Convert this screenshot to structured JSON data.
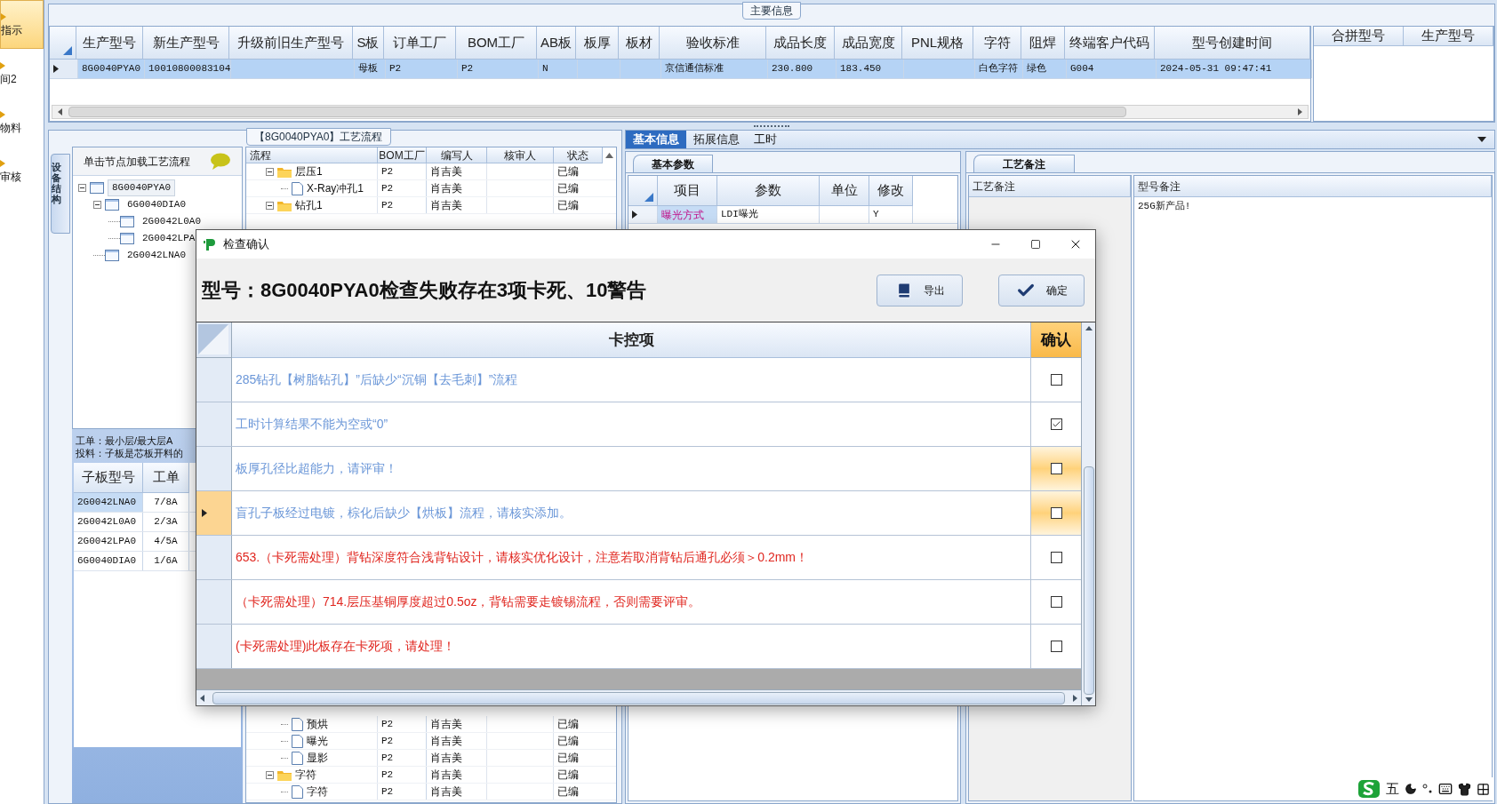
{
  "nav": {
    "items": [
      {
        "label": "指示",
        "selected": true
      },
      {
        "label": "间2",
        "selected": false
      },
      {
        "label": "物料",
        "selected": false
      },
      {
        "label": "审核",
        "selected": false
      }
    ]
  },
  "main_info": {
    "title": "主要信息",
    "columns": [
      "生产型号",
      "新生产型号",
      "升级前旧生产型号",
      "S板",
      "订单工厂",
      "BOM工厂",
      "AB板",
      "板厚",
      "板材",
      "验收标准",
      "成品长度",
      "成品宽度",
      "PNL规格",
      "字符",
      "阻焊",
      "终端客户代码",
      "型号创建时间"
    ],
    "rows": [
      {
        "selected": true,
        "cells": [
          "8G0040PYA0",
          "10010800083104",
          null,
          "母板",
          "P2",
          "P2",
          "N",
          null,
          null,
          "京信通信标准",
          "230.800",
          "183.450",
          null,
          "白色字符",
          "绿色",
          "G004",
          "2024-05-31 09:47:41"
        ]
      }
    ]
  },
  "merge_table": {
    "columns": [
      "合拼型号",
      "生产型号"
    ]
  },
  "flow_panel": {
    "title": "【8G0040PYA0】工艺流程",
    "side_tab": "设备结构",
    "tree_header": "单击节点加载工艺流程",
    "tree": [
      {
        "label": "8G0040PYA0",
        "selected": true,
        "expanded": true,
        "children": [
          {
            "label": "6G0040DIA0",
            "selected": false,
            "expanded": true,
            "children": [
              {
                "label": "2G0042L0A0",
                "selected": false
              },
              {
                "label": "2G0042LPA",
                "selected": false
              }
            ]
          },
          {
            "label": "2G0042LNA0",
            "selected": false
          }
        ]
      }
    ],
    "notes": [
      "工单：最小层/最大层A",
      "投料：子板是芯板开料的"
    ],
    "sub_table": {
      "columns": [
        "子板型号",
        "工单"
      ],
      "rows": [
        {
          "selected": true,
          "cells": [
            "2G0042LNA0",
            "7/8A"
          ]
        },
        {
          "selected": false,
          "cells": [
            "2G0042L0A0",
            "2/3A"
          ]
        },
        {
          "selected": false,
          "cells": [
            "2G0042LPA0",
            "4/5A"
          ]
        },
        {
          "selected": false,
          "cells": [
            "6G0040DIA0",
            "1/6A"
          ]
        }
      ]
    },
    "process_table": {
      "columns": [
        "流程",
        "BOM工厂",
        "编写人",
        "核审人",
        "状态"
      ],
      "rows_top": [
        {
          "name": "层压1",
          "kind": "folder",
          "expanded": true,
          "bom": "P2",
          "writer": "肖吉美",
          "status": "已编",
          "children": [
            {
              "name": "X-Ray冲孔1",
              "kind": "step",
              "bom": "P2",
              "writer": "肖吉美",
              "status": "已编"
            }
          ]
        },
        {
          "name": "钻孔1",
          "kind": "folder",
          "expanded": true,
          "bom": "P2",
          "writer": "肖吉美",
          "status": "已编"
        }
      ],
      "rows_bottom": [
        {
          "children": [
            {
              "name": "预烘",
              "kind": "step",
              "bom": "P2",
              "writer": "肖吉美",
              "status": "已编"
            },
            {
              "name": "曝光",
              "kind": "step",
              "bom": "P2",
              "writer": "肖吉美",
              "status": "已编"
            },
            {
              "name": "显影",
              "kind": "step",
              "bom": "P2",
              "writer": "肖吉美",
              "status": "已编"
            }
          ]
        },
        {
          "name": "字符",
          "kind": "folder",
          "expanded": true,
          "bom": "P2",
          "writer": "肖吉美",
          "status": "已编",
          "children": [
            {
              "name": "字符",
              "kind": "step",
              "bom": "P2",
              "writer": "肖吉美",
              "status": "已编"
            }
          ]
        }
      ]
    }
  },
  "detail_tabs": [
    {
      "label": "基本信息",
      "selected": true
    },
    {
      "label": "拓展信息",
      "selected": false
    },
    {
      "label": "工时",
      "selected": false
    }
  ],
  "params": {
    "tab": "基本参数",
    "columns": [
      "项目",
      "参数",
      "单位",
      "修改"
    ],
    "rows": [
      {
        "selected": true,
        "cells": [
          "曝光方式",
          "LDI曝光",
          null,
          "Y"
        ]
      }
    ]
  },
  "remarks": {
    "tab": "工艺备注",
    "columns": [
      "工艺备注",
      "型号备注"
    ],
    "model_remark": "25G新产品!"
  },
  "dialog": {
    "title": "检查确认",
    "heading": "型号：8G0040PYA0检查失败存在3项卡死、10警告",
    "buttons": [
      {
        "label": "导出",
        "kind": "export"
      },
      {
        "label": "确定",
        "kind": "ok"
      }
    ],
    "columns": [
      "卡控项",
      "确认"
    ],
    "rows": [
      {
        "text": "285钻孔【树脂钻孔】”后缺少“沉铜【去毛刺】”流程",
        "kind": "warning",
        "checked": false,
        "highlighted": false,
        "selected": false
      },
      {
        "text": "工时计算结果不能为空或“0”",
        "kind": "warning",
        "checked": true,
        "highlighted": false,
        "selected": false
      },
      {
        "text": "板厚孔径比超能力，请评审！",
        "kind": "warning",
        "checked": false,
        "highlighted": true,
        "selected": false
      },
      {
        "text": "盲孔子板经过电镀，棕化后缺少【烘板】流程，请核实添加。",
        "kind": "warning",
        "checked": false,
        "highlighted": true,
        "selected": true
      },
      {
        "text": "653.（卡死需处理）背钻深度符合浅背钻设计，请核实优化设计，注意若取消背钻后通孔必须＞0.2mm！",
        "kind": "fatal",
        "checked": false,
        "highlighted": false,
        "selected": false
      },
      {
        "text": "（卡死需处理）714.层压基铜厚度超过0.5oz，背钻需要走镀锡流程，否则需要评审。",
        "kind": "fatal",
        "checked": false,
        "highlighted": false,
        "selected": false
      },
      {
        "text": "(卡死需处理)此板存在卡死项，请处理！",
        "kind": "fatal",
        "checked": false,
        "highlighted": false,
        "selected": false
      }
    ]
  },
  "ime": {
    "mode": "五"
  }
}
